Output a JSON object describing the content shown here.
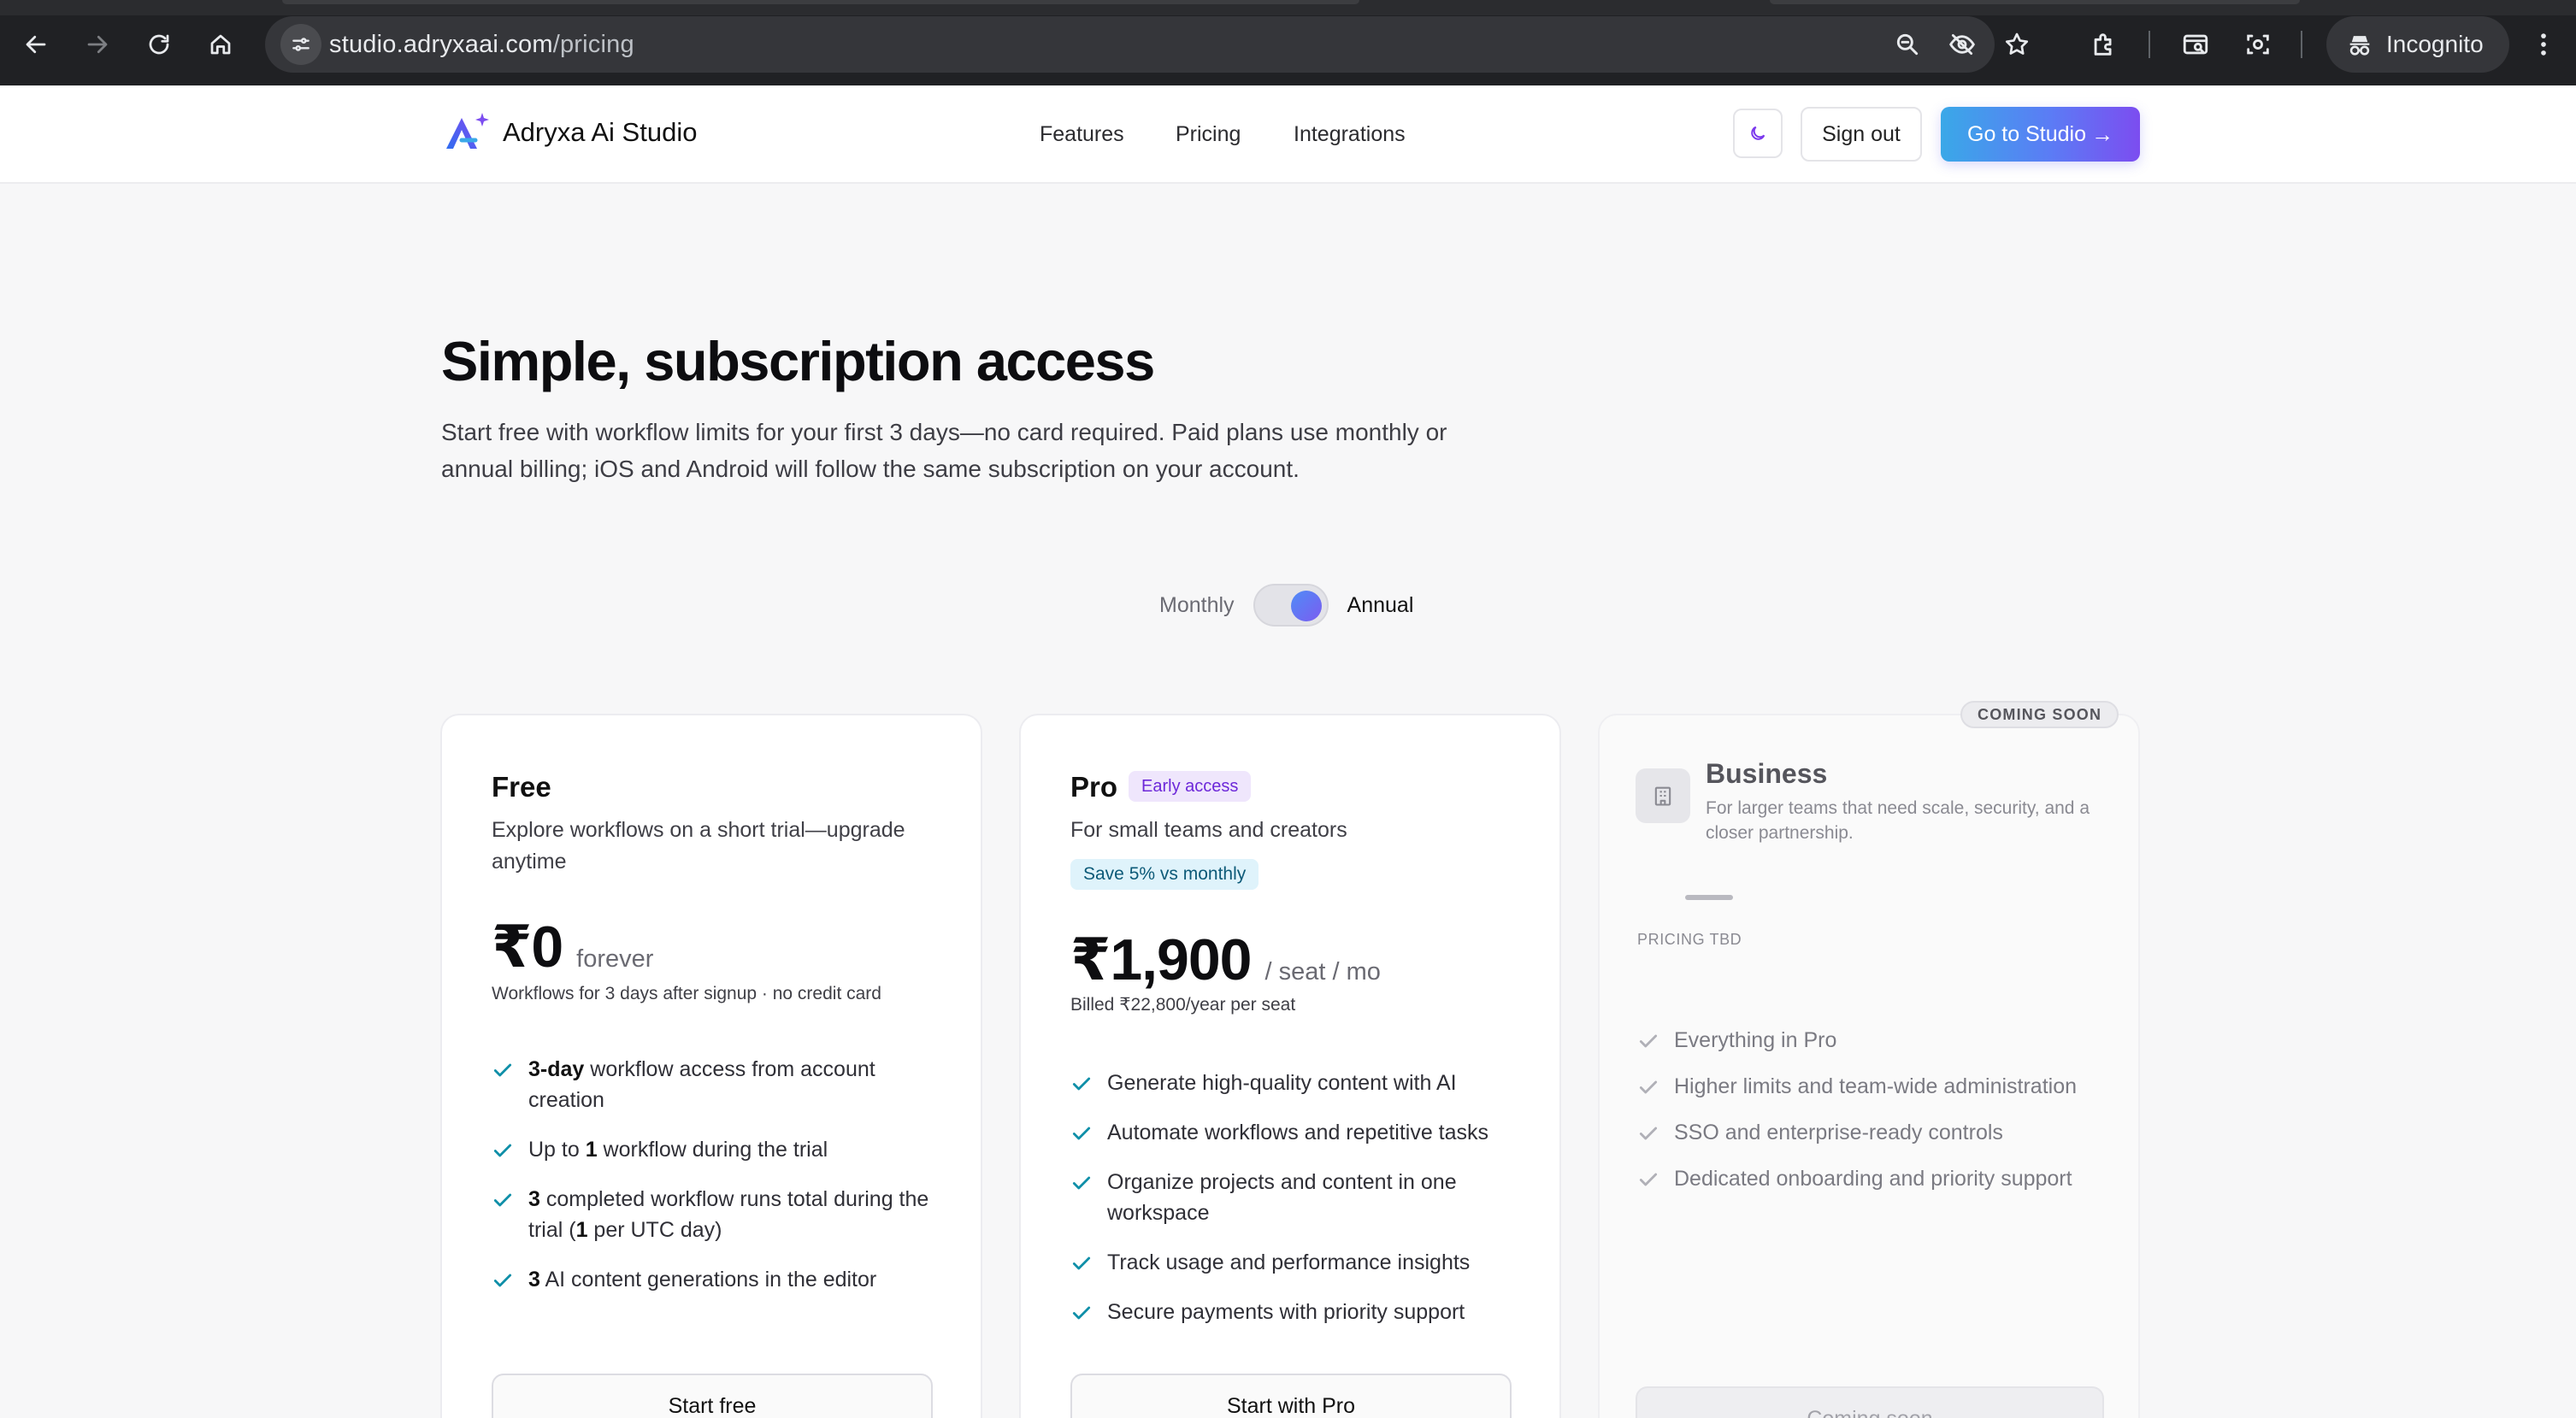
{
  "browser": {
    "url_host": "studio.adryxaai.com",
    "url_path": "/pricing",
    "incognito_label": "Incognito",
    "icons": [
      "back-icon",
      "forward-icon",
      "reload-icon",
      "home-icon",
      "site-info-icon",
      "zoom-icon",
      "eye-off-icon",
      "star-icon",
      "extensions-icon",
      "tab-search-icon",
      "screenshot-icon",
      "incognito-icon",
      "more-icon"
    ]
  },
  "header": {
    "brand_name": "Adryxa Ai Studio",
    "nav": [
      "Features",
      "Pricing",
      "Integrations"
    ],
    "sign_out": "Sign out",
    "cta": "Go to Studio",
    "cta_arrow": "→",
    "accent_gradient": [
      "#3aa8e8",
      "#7c4df0"
    ]
  },
  "hero": {
    "title": "Simple, subscription access",
    "subtitle": "Start free with workflow limits for your first 3 days—no card required. Paid plans use monthly or annual billing; iOS and Android will follow the same subscription on your account."
  },
  "billing": {
    "monthly_label": "Monthly",
    "annual_label": "Annual",
    "selected": "Annual"
  },
  "plans": {
    "free": {
      "name": "Free",
      "description": "Explore workflows on a short trial—upgrade anytime",
      "price": "₹0",
      "price_suffix": "forever",
      "note": "Workflows for 3 days after signup · no credit card",
      "features": [
        {
          "bold": "3-day",
          "rest": " workflow access from account creation"
        },
        {
          "pre": "Up to ",
          "bold": "1",
          "rest": " workflow during the trial"
        },
        {
          "bold": "3",
          "rest": " completed workflow runs total during the trial (",
          "bold2": "1",
          "rest2": " per UTC day)"
        },
        {
          "bold": "3",
          "rest": " AI content generations in the editor"
        }
      ],
      "button": "Start free"
    },
    "pro": {
      "name": "Pro",
      "badge": "Early access",
      "description": "For small teams and creators",
      "save_badge": "Save 5% vs monthly",
      "price": "₹1,900",
      "price_suffix": "/ seat / mo",
      "note": "Billed ₹22,800/year per seat",
      "features": [
        "Generate high-quality content with AI",
        "Automate workflows and repetitive tasks",
        "Organize projects and content in one workspace",
        "Track usage and performance insights",
        "Secure payments with priority support"
      ],
      "button": "Start with Pro"
    },
    "business": {
      "status_badge": "COMING SOON",
      "name": "Business",
      "description": "For larger teams that need scale, security, and a closer partnership.",
      "pricing_label": "PRICING TBD",
      "features": [
        "Everything in Pro",
        "Higher limits and team-wide administration",
        "SSO and enterprise-ready controls",
        "Dedicated onboarding and priority support"
      ],
      "button": "Coming soon"
    }
  }
}
